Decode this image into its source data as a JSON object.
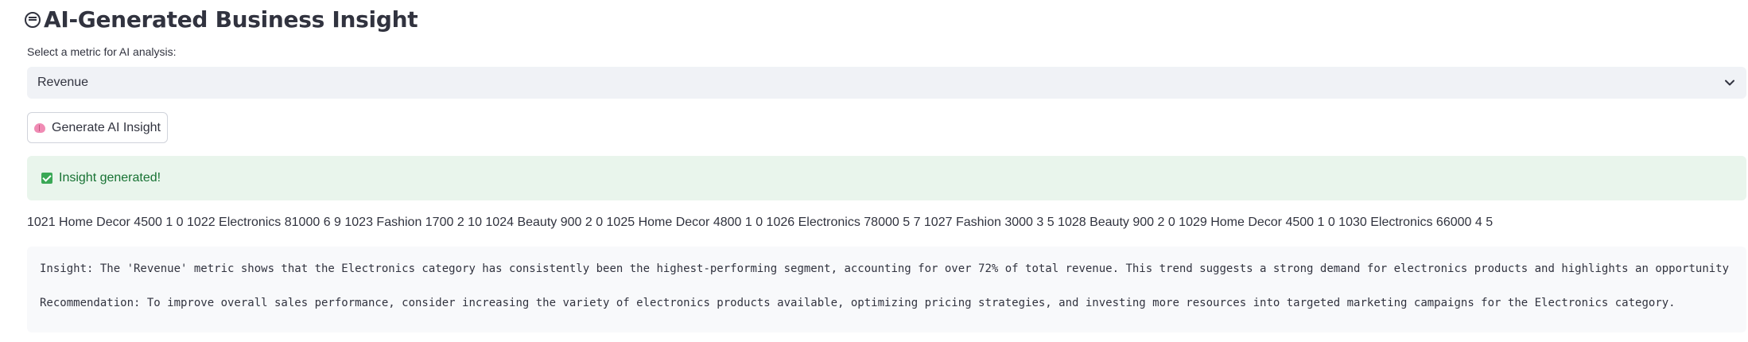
{
  "header": {
    "title": "AI-Generated Business Insight",
    "title_icon": "grimacing-face-icon"
  },
  "metric_select": {
    "label": "Select a metric for AI analysis:",
    "selected": "Revenue"
  },
  "generate_button": {
    "label": "Generate AI Insight",
    "icon": "brain-icon"
  },
  "success_alert": {
    "text": "Insight generated!",
    "icon": "check-mark-button-icon",
    "color": "#177233",
    "background": "#e9f5ec"
  },
  "raw_data_line": "1021 Home Decor 4500 1 0 1022 Electronics 81000 6 9 1023 Fashion 1700 2 10 1024 Beauty 900 2 0 1025 Home Decor 4800 1 0 1026 Electronics 78000 5 7 1027 Fashion 3000 3 5 1028 Beauty 900 2 0 1029 Home Decor 4500 1 0 1030 Electronics 66000 4 5",
  "insight_output": {
    "insight": "Insight: The 'Revenue' metric shows that the Electronics category has consistently been the highest-performing segment, accounting for over 72% of total revenue. This trend suggests a strong demand for electronics products and highlights an opportunity",
    "recommendation": "Recommendation: To improve overall sales performance, consider increasing the variety of electronics products available, optimizing pricing strategies, and investing more resources into targeted marketing campaigns for the Electronics category."
  }
}
